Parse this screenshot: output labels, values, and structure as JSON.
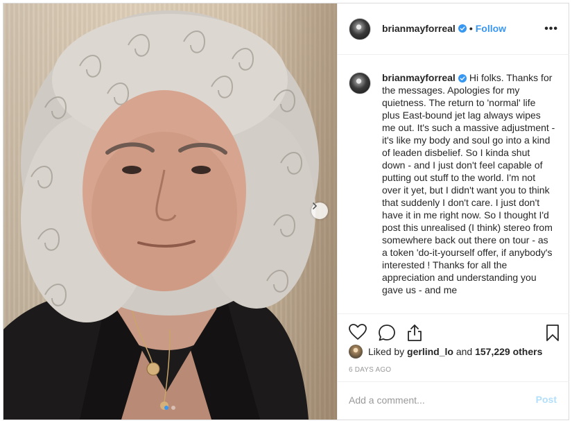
{
  "post": {
    "username": "brianmayforreal",
    "separator": "•",
    "follow_label": "Follow",
    "more_label": "•••",
    "caption_text": "Hi folks. Thanks for the messages. Apologies for my quietness. The return to 'normal' life plus East-bound jet lag always wipes me out. It's such a massive adjustment - it's like my body and soul go into a kind of leaden disbelief. So I kinda shut down - and I just don't feel capable of putting out stuff to the world. I'm not over it yet, but I didn't want you to think that suddenly I don't care. I just don't have it in me right now. So I thought I'd post this unrealised (I think) stereo from somewhere back out there on tour - as a token 'do-it-yourself offer, if anybody's interested ! Thanks for all the appreciation and understanding you gave us - and me",
    "likes": {
      "prefix": "Liked by",
      "user": "gerlind_lo",
      "conjunction": "and",
      "count": "157,229 others"
    },
    "timestamp": "6 DAYS AGO",
    "comment_placeholder": "Add a comment...",
    "post_label": "Post",
    "carousel": {
      "total": 2,
      "current": 1
    }
  },
  "colors": {
    "accent": "#3897f0",
    "post_disabled": "#b2dffc",
    "muted": "#999999"
  },
  "icons": [
    "verified-badge-icon",
    "more-options-icon",
    "carousel-next-icon",
    "heart-icon",
    "comment-icon",
    "share-icon",
    "bookmark-icon"
  ]
}
